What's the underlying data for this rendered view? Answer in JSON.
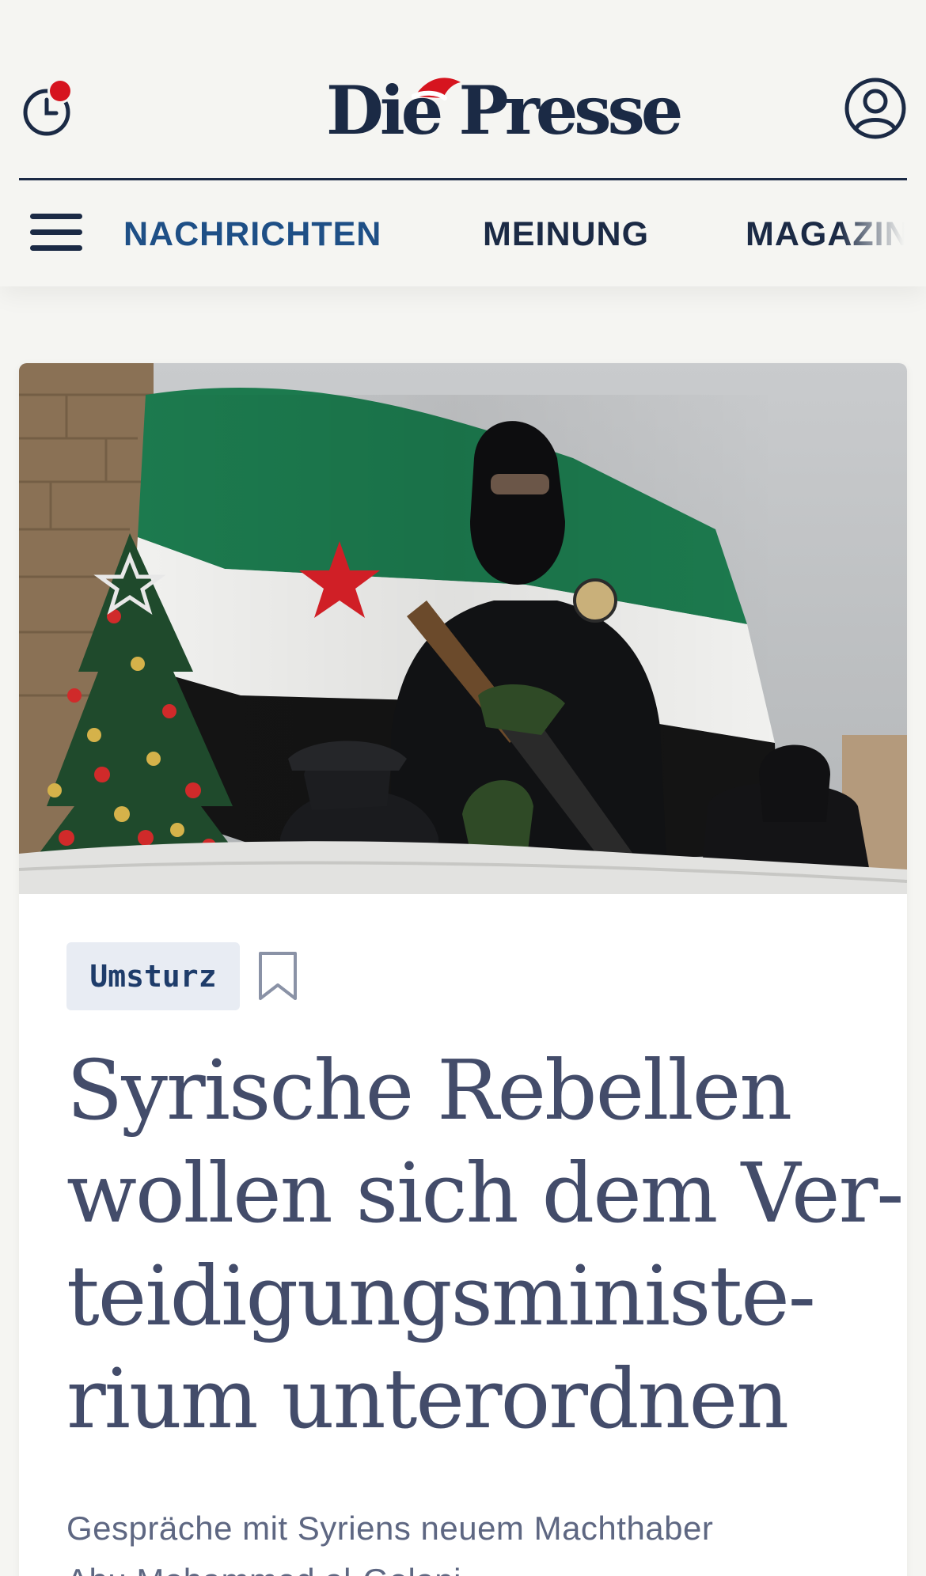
{
  "header": {
    "logo_text": "Die Presse",
    "notification_dot_color": "#d6141f",
    "icons": {
      "history": "clock-icon",
      "account": "user-account-icon",
      "menu": "hamburger-menu-icon"
    }
  },
  "nav": {
    "items": [
      {
        "label": "NACHRICHTEN",
        "active": true
      },
      {
        "label": "MEINUNG",
        "active": false
      },
      {
        "label": "MAGAZIN",
        "active": false
      }
    ],
    "active_color": "#1e4f86",
    "default_color": "#1b2a45"
  },
  "article": {
    "tag": "Umsturz",
    "headline_lines": [
      "Syrische Rebellen",
      "wollen sich dem Ver-",
      "teidigungsministe-",
      "rium unterordnen"
    ],
    "teaser_lines": [
      "Gespräche mit Syriens neuem Machthaber",
      "Abu Mohammed al-Golani"
    ],
    "image_description_icon": "article-hero-image"
  },
  "colors": {
    "background": "#f5f5f2",
    "card": "#ffffff",
    "tag_background": "#e8ecf3",
    "headline": "#434c6a"
  }
}
